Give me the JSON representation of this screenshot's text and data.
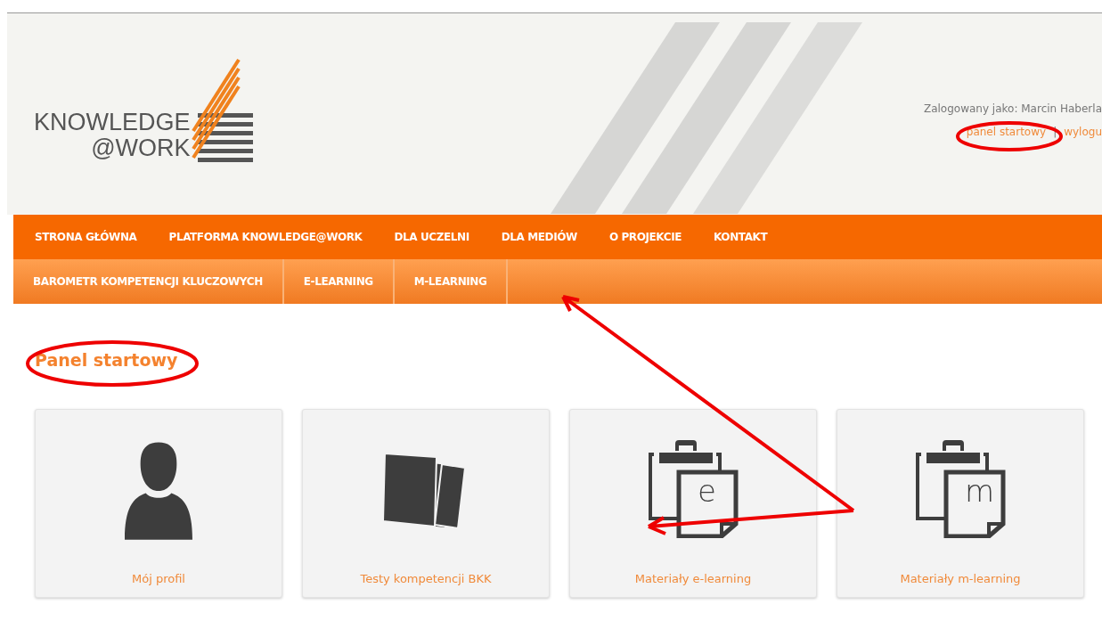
{
  "header": {
    "logo": {
      "line_1": "KNOWLEDGE",
      "line_2": "@WORK"
    },
    "user": {
      "label": "Zalogowany jako: Marcin Haberla",
      "links": [
        "panel startowy",
        "wylogu"
      ],
      "separator": "|"
    }
  },
  "main_nav": [
    "STRONA GŁÓWNA",
    "PLATFORMA KNOWLEDGE@WORK",
    "DLA UCZELNI",
    "DLA MEDIÓW",
    "O PROJEKCIE",
    "KONTAKT"
  ],
  "sub_nav": [
    "BAROMETR KOMPETENCJI KLUCZOWYCH",
    "E-LEARNING",
    "M-LEARNING"
  ],
  "panel": {
    "title": "Panel startowy",
    "cards": [
      {
        "kind": "person",
        "label": "Mój profil"
      },
      {
        "kind": "papers",
        "label": "Testy kompetencji BKK"
      },
      {
        "kind": "clipboard",
        "letter": "e",
        "label": "Materiały e-learning"
      },
      {
        "kind": "clipboard",
        "letter": "m",
        "label": "Materiały m-learning"
      }
    ]
  }
}
